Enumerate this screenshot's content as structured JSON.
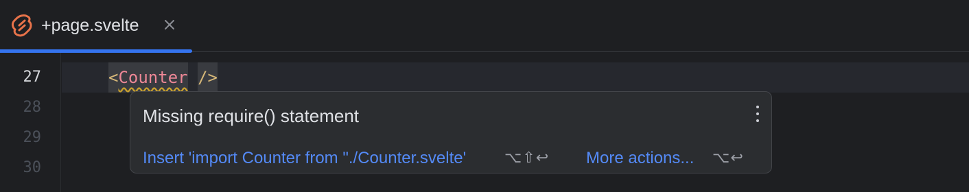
{
  "tab": {
    "label": "+page.svelte",
    "icon": "svelte-icon",
    "close_icon": "close-icon",
    "accent_color": "#3574f0"
  },
  "editor": {
    "lines": [
      "27",
      "28",
      "29",
      "30"
    ],
    "current_line": "27",
    "code": {
      "open": "<",
      "tag": "Counter",
      "space": " ",
      "close": "/>"
    }
  },
  "popup": {
    "title": "Missing require() statement",
    "menu_icon": "more-vertical-icon",
    "primary_action": "Insert 'import Counter from \"./Counter.svelte'",
    "primary_shortcut": "⌥⇧↩",
    "secondary_action": "More actions...",
    "secondary_shortcut": "⌥↩",
    "link_color": "#548af7"
  }
}
